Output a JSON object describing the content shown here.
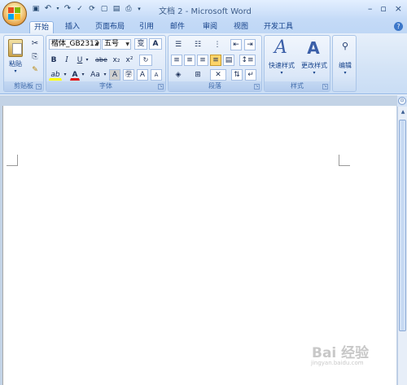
{
  "app": {
    "title": "文档 2 - Microsoft Word"
  },
  "qat": {
    "save_icon": "💾",
    "undo_icon": "↶",
    "redo_icon": "↷",
    "more": "▾"
  },
  "tabs": [
    {
      "label": "开始",
      "active": true
    },
    {
      "label": "插入",
      "active": false
    },
    {
      "label": "页面布局",
      "active": false
    },
    {
      "label": "引用",
      "active": false
    },
    {
      "label": "邮件",
      "active": false
    },
    {
      "label": "审阅",
      "active": false
    },
    {
      "label": "视图",
      "active": false
    },
    {
      "label": "开发工具",
      "active": false
    }
  ],
  "ribbon": {
    "clipboard": {
      "paste_label": "粘贴",
      "group_label": "剪贴板"
    },
    "font": {
      "font_name": "楷体_GB2312",
      "font_size": "五号",
      "group_label": "字体",
      "bold": "B",
      "italic": "I",
      "underline": "U",
      "strike": "abe",
      "subscript": "x₂",
      "superscript": "x²",
      "grow": "A",
      "shrink": "A",
      "char_border": "A",
      "enclose": "㊫",
      "case": "Aa",
      "highlight": "ab",
      "font_color": "A",
      "phonetic": "A",
      "wen": "变"
    },
    "paragraph": {
      "group_label": "段落"
    },
    "styles": {
      "quick_styles": "快速样式",
      "change_styles": "更改样式",
      "group_label": "样式"
    },
    "editing": {
      "label": "编辑"
    }
  },
  "colors": {
    "accent": "#15428b",
    "ribbon_bg": "#dce8f8",
    "highlight_yellow": "#ffff00",
    "font_red": "#e01010"
  },
  "watermark": {
    "text": "Bai 经验",
    "sub": "jingyan.baidu.com"
  }
}
